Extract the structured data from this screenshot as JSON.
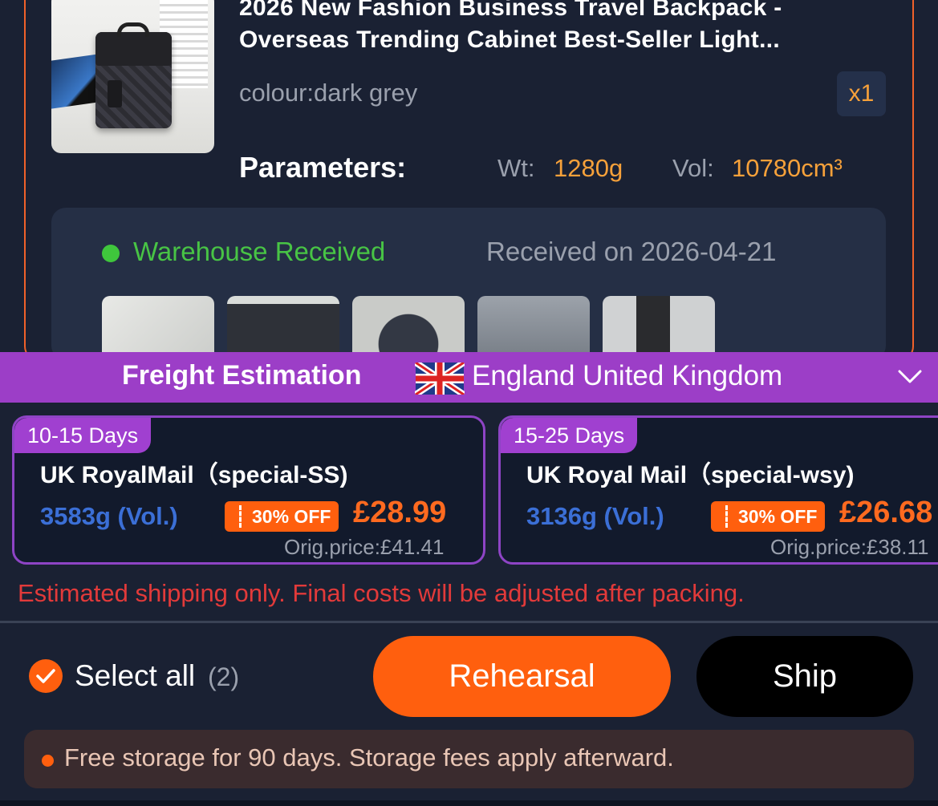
{
  "product": {
    "title_line1": "2026 New Fashion Business Travel Backpack -",
    "title_line2": "Overseas Trending Cabinet Best-Seller Light...",
    "colour": "colour:dark grey",
    "quantity": "x1",
    "parameters_label": "Parameters:",
    "weight_label": "Wt:",
    "weight_value": "1280g",
    "volume_label": "Vol:",
    "volume_value": "10780cm³",
    "image_icon": "backpack-photo"
  },
  "warehouse": {
    "status": "Warehouse Received",
    "received_date": "Received on 2026-04-21",
    "photos_count": 5
  },
  "freight": {
    "title": "Freight Estimation",
    "country": "England United Kingdom",
    "flag_icon": "uk-flag-icon",
    "options": [
      {
        "days": "10-15 Days",
        "carrier": "UK RoyalMail（special-SS)",
        "weight": "3583g (Vol.)",
        "discount": "30% OFF",
        "price": "£28.99",
        "orig_price": "Orig.price:£41.41"
      },
      {
        "days": "15-25 Days",
        "carrier": "UK Royal Mail（special-wsy)",
        "weight": "3136g (Vol.)",
        "discount": "30% OFF",
        "price": "£26.68",
        "orig_price": "Orig.price:£38.11"
      }
    ],
    "notice": "Estimated shipping only. Final costs will be adjusted after packing."
  },
  "footer": {
    "select_all": "Select all",
    "select_count": "(2)",
    "rehearsal_label": "Rehearsal",
    "ship_label": "Ship",
    "storage_notice": "Free storage for 90 days. Storage fees apply afterward."
  },
  "colors": {
    "accent_orange": "#ff5f0e",
    "purple": "#9c3ec7",
    "green": "#48c445",
    "red": "#e23a3a",
    "background": "#1a2133"
  }
}
